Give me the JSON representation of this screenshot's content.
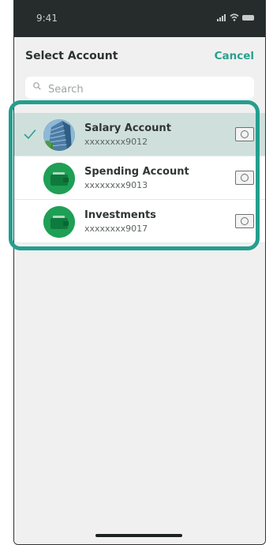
{
  "status": {
    "time": "9:41"
  },
  "header": {
    "title": "Select Account",
    "cancel_label": "Cancel"
  },
  "search": {
    "placeholder": "Search"
  },
  "accounts": [
    {
      "name": "Salary Account",
      "number": "xxxxxxxx9012",
      "selected": true,
      "avatar": "building-photo"
    },
    {
      "name": "Spending Account",
      "number": "xxxxxxxx9013",
      "selected": false,
      "avatar": "wallet-icon"
    },
    {
      "name": "Investments",
      "number": "xxxxxxxx9017",
      "selected": false,
      "avatar": "wallet-icon"
    }
  ],
  "colors": {
    "accent": "#29a08f",
    "highlight_border": "#249e8e",
    "selected_row": "#cfe0dc",
    "wallet_green": "#1f9f55"
  }
}
